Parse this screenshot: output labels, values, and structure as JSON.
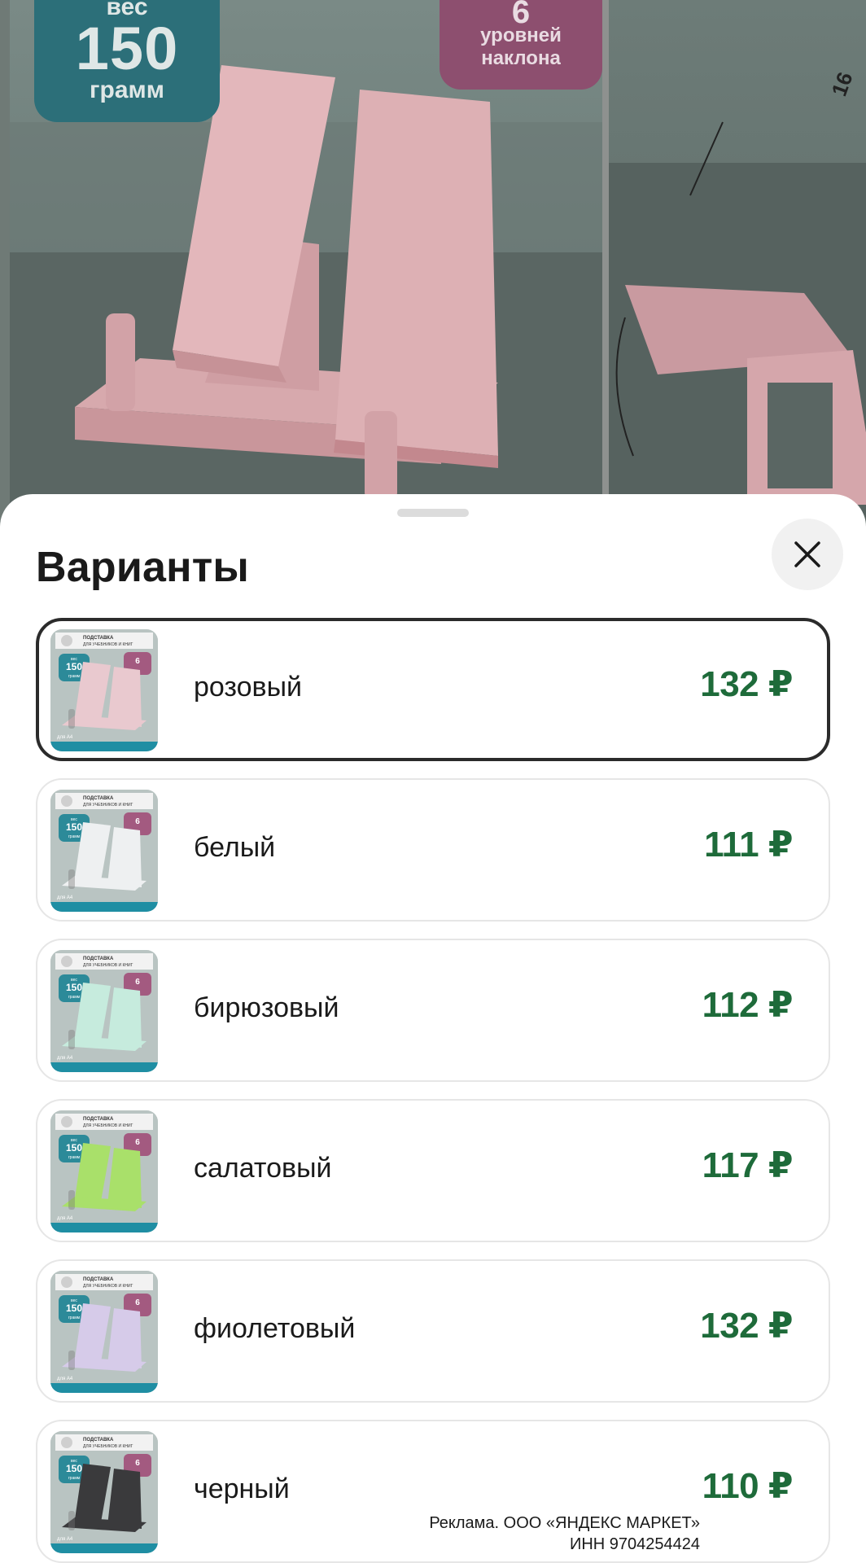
{
  "gallery": {
    "weight_badge": {
      "label": "вес",
      "value": "150",
      "unit": "грамм"
    },
    "tilt_badge": {
      "value": "6",
      "text_line1": "уровней",
      "text_line2": "наклона"
    },
    "dimension_label": "16"
  },
  "sheet": {
    "title": "Варианты",
    "close_icon": "close-icon"
  },
  "variants": [
    {
      "name": "розовый",
      "price": "132 ₽",
      "selected": true,
      "color": "#e9c9cf"
    },
    {
      "name": "белый",
      "price": "111 ₽",
      "selected": false,
      "color": "#eef0f1"
    },
    {
      "name": "бирюзовый",
      "price": "112 ₽",
      "selected": false,
      "color": "#c6ebdd"
    },
    {
      "name": "салатовый",
      "price": "117 ₽",
      "selected": false,
      "color": "#a9e06a"
    },
    {
      "name": "фиолетовый",
      "price": "132 ₽",
      "selected": false,
      "color": "#d6cbe9"
    },
    {
      "name": "черный",
      "price": "110 ₽",
      "selected": false,
      "color": "#3a3a3c"
    }
  ],
  "thumbnail_text": {
    "header_line1": "ПОДСТАВКА",
    "header_line2": "ДЛЯ УЧЕБНИКОВ И КНИГ",
    "weight_label": "вес",
    "weight_value": "150",
    "weight_unit": "грамм",
    "tilt_value": "6",
    "format": "для А4"
  },
  "ad": {
    "line1": "Реклама. ООО «ЯНДЕКС МАРКЕТ»",
    "line2": "ИНН 9704254424"
  },
  "colors": {
    "price_green": "#1e6b3a",
    "selected_border": "#2b2b2b",
    "badge_teal": "#2c6f79",
    "badge_magenta": "#8d4f6f"
  }
}
